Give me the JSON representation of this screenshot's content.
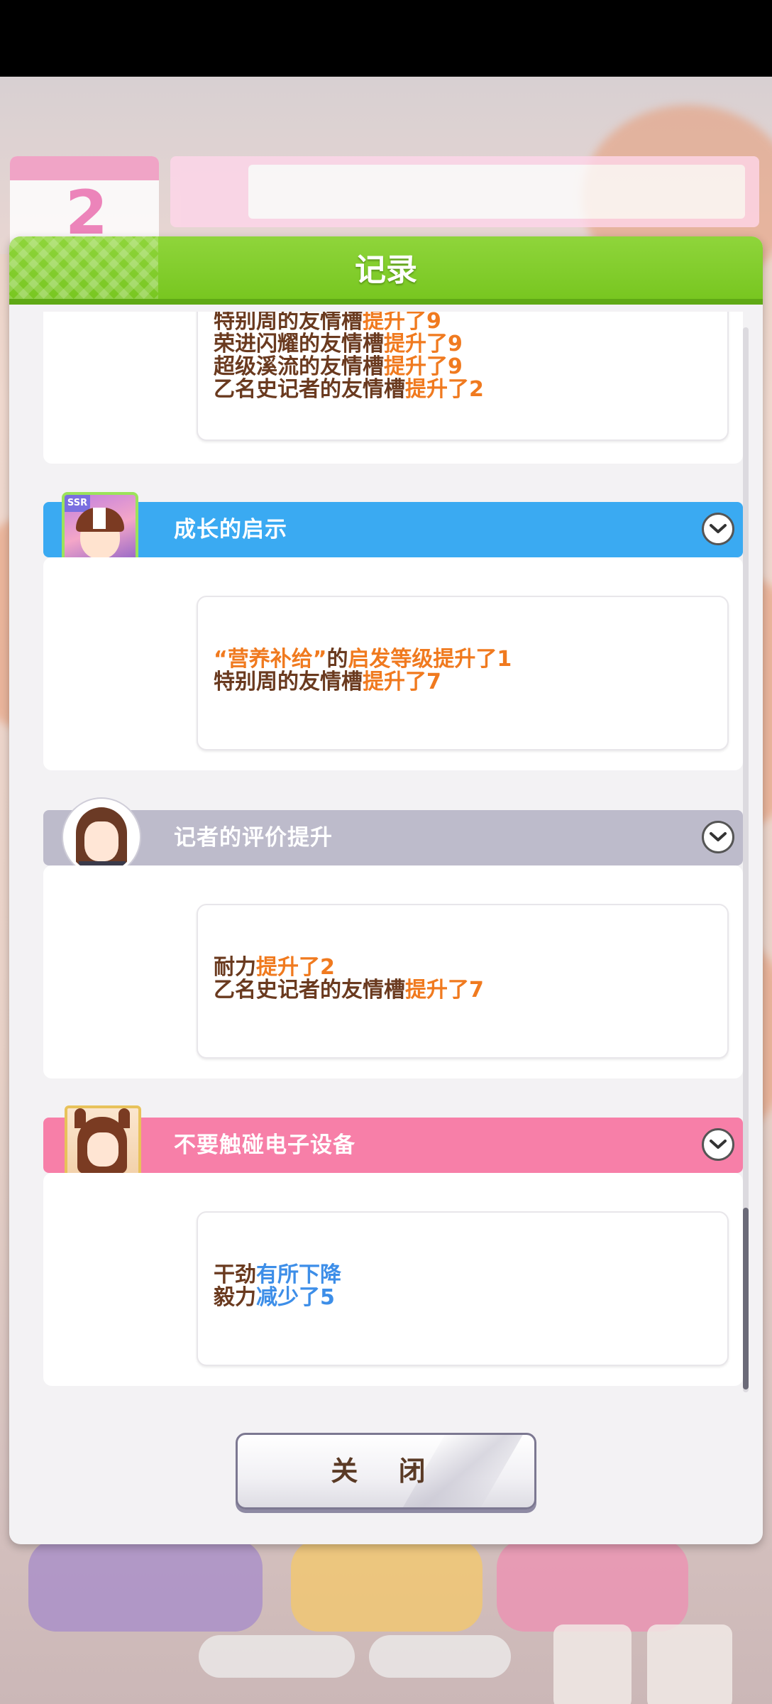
{
  "dialog": {
    "title": "记录",
    "close_label": "关 闭"
  },
  "background": {
    "calendar_number": "2"
  },
  "entries": [
    {
      "lines": [
        [
          {
            "t": "特别周的友情槽",
            "c": "n"
          },
          {
            "t": "提升了9",
            "c": "o"
          }
        ],
        [
          {
            "t": "荣进闪耀的友情槽",
            "c": "n"
          },
          {
            "t": "提升了9",
            "c": "o"
          }
        ],
        [
          {
            "t": "超级溪流的友情槽",
            "c": "n"
          },
          {
            "t": "提升了9",
            "c": "o"
          }
        ],
        [
          {
            "t": "乙名史记者的友情槽",
            "c": "n"
          },
          {
            "t": "提升了2",
            "c": "o"
          }
        ]
      ]
    },
    {
      "event_title": "成长的启示",
      "bar_color": "#3aaaf2",
      "avatar_badge": "SSR",
      "lines": [
        [
          {
            "t": "“营养补给”",
            "c": "o"
          },
          {
            "t": "的",
            "c": "n"
          },
          {
            "t": "启发等级提升了1",
            "c": "o"
          }
        ],
        [
          {
            "t": "特别周的友情槽",
            "c": "n"
          },
          {
            "t": "提升了7",
            "c": "o"
          }
        ]
      ]
    },
    {
      "event_title": "记者的评价提升",
      "bar_color": "#bdbbcb",
      "lines": [
        [
          {
            "t": "耐力",
            "c": "n"
          },
          {
            "t": "提升了2",
            "c": "o"
          }
        ],
        [
          {
            "t": "乙名史记者的友情槽",
            "c": "n"
          },
          {
            "t": "提升了7",
            "c": "o"
          }
        ]
      ]
    },
    {
      "event_title": "不要触碰电子设备",
      "bar_color": "#f77fa8",
      "lines": [
        [
          {
            "t": "干劲",
            "c": "n"
          },
          {
            "t": "有所下降",
            "c": "b"
          }
        ],
        [
          {
            "t": "毅力",
            "c": "n"
          },
          {
            "t": "减少了5",
            "c": "b"
          }
        ]
      ]
    }
  ],
  "icons": {
    "expand": "chevron-down-icon",
    "close_decor": "slash-decoration"
  }
}
